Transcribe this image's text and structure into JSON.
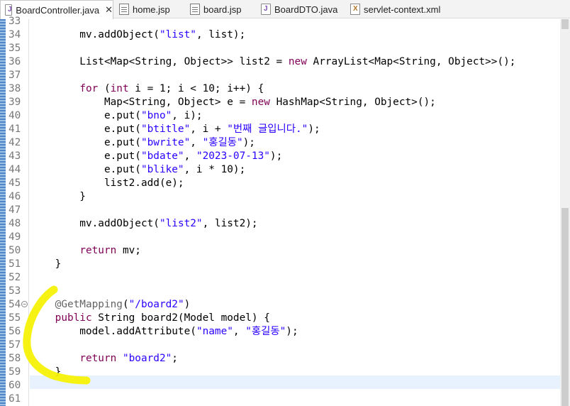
{
  "tabs": [
    {
      "label": "BoardController.java",
      "icon": "java-file-icon",
      "active": true,
      "close": "✕"
    },
    {
      "label": "home.jsp",
      "icon": "jsp-file-icon",
      "active": false
    },
    {
      "label": "board.jsp",
      "icon": "jsp-file-icon",
      "active": false
    },
    {
      "label": "BoardDTO.java",
      "icon": "java-file-icon",
      "active": false
    },
    {
      "label": "servlet-context.xml",
      "icon": "xml-file-icon",
      "active": false
    }
  ],
  "editor": {
    "current_line": 60,
    "lines": [
      {
        "n": "33",
        "tokens": []
      },
      {
        "n": "34",
        "tokens": [
          [
            "p",
            "        mv.addObject("
          ],
          [
            "s",
            "\"list\""
          ],
          [
            "p",
            ", list);"
          ]
        ]
      },
      {
        "n": "35",
        "tokens": []
      },
      {
        "n": "36",
        "tokens": [
          [
            "p",
            "        List<Map<String, Object>> list2 = "
          ],
          [
            "k",
            "new"
          ],
          [
            "p",
            " ArrayList<Map<String, Object>>();"
          ]
        ]
      },
      {
        "n": "37",
        "tokens": []
      },
      {
        "n": "38",
        "tokens": [
          [
            "p",
            "        "
          ],
          [
            "k",
            "for"
          ],
          [
            "p",
            " ("
          ],
          [
            "k",
            "int"
          ],
          [
            "p",
            " i = 1; i < 10; i++) {"
          ]
        ]
      },
      {
        "n": "39",
        "tokens": [
          [
            "p",
            "            Map<String, Object> e = "
          ],
          [
            "k",
            "new"
          ],
          [
            "p",
            " HashMap<String, Object>();"
          ]
        ]
      },
      {
        "n": "40",
        "tokens": [
          [
            "p",
            "            e.put("
          ],
          [
            "s",
            "\"bno\""
          ],
          [
            "p",
            ", i);"
          ]
        ]
      },
      {
        "n": "41",
        "tokens": [
          [
            "p",
            "            e.put("
          ],
          [
            "s",
            "\"btitle\""
          ],
          [
            "p",
            ", i + "
          ],
          [
            "s",
            "\"번째 글입니다.\""
          ],
          [
            "p",
            ");"
          ]
        ]
      },
      {
        "n": "42",
        "tokens": [
          [
            "p",
            "            e.put("
          ],
          [
            "s",
            "\"bwrite\""
          ],
          [
            "p",
            ", "
          ],
          [
            "s",
            "\"홍길동\""
          ],
          [
            "p",
            ");"
          ]
        ]
      },
      {
        "n": "43",
        "tokens": [
          [
            "p",
            "            e.put("
          ],
          [
            "s",
            "\"bdate\""
          ],
          [
            "p",
            ", "
          ],
          [
            "s",
            "\"2023-07-13\""
          ],
          [
            "p",
            ");"
          ]
        ]
      },
      {
        "n": "44",
        "tokens": [
          [
            "p",
            "            e.put("
          ],
          [
            "s",
            "\"blike\""
          ],
          [
            "p",
            ", i * 10);"
          ]
        ]
      },
      {
        "n": "45",
        "tokens": [
          [
            "p",
            "            list2.add(e);"
          ]
        ]
      },
      {
        "n": "46",
        "tokens": [
          [
            "p",
            "        }"
          ]
        ]
      },
      {
        "n": "47",
        "tokens": []
      },
      {
        "n": "48",
        "tokens": [
          [
            "p",
            "        mv.addObject("
          ],
          [
            "s",
            "\"list2\""
          ],
          [
            "p",
            ", list2);"
          ]
        ]
      },
      {
        "n": "49",
        "tokens": []
      },
      {
        "n": "50",
        "tokens": [
          [
            "p",
            "        "
          ],
          [
            "k",
            "return"
          ],
          [
            "p",
            " mv;"
          ]
        ]
      },
      {
        "n": "51",
        "tokens": [
          [
            "p",
            "    }"
          ]
        ]
      },
      {
        "n": "52",
        "tokens": []
      },
      {
        "n": "53",
        "tokens": []
      },
      {
        "n": "54",
        "fold": "−",
        "tokens": [
          [
            "a",
            "    @GetMapping"
          ],
          [
            "p",
            "("
          ],
          [
            "s",
            "\"/board2\""
          ],
          [
            "p",
            ")"
          ]
        ]
      },
      {
        "n": "55",
        "tokens": [
          [
            "p",
            "    "
          ],
          [
            "k",
            "public"
          ],
          [
            "p",
            " String board2(Model model) {"
          ]
        ]
      },
      {
        "n": "56",
        "tokens": [
          [
            "p",
            "        model.addAttribute("
          ],
          [
            "s",
            "\"name\""
          ],
          [
            "p",
            ", "
          ],
          [
            "s",
            "\"홍길동\""
          ],
          [
            "p",
            ");"
          ]
        ]
      },
      {
        "n": "57",
        "tokens": []
      },
      {
        "n": "58",
        "tokens": [
          [
            "p",
            "        "
          ],
          [
            "k",
            "return"
          ],
          [
            "p",
            " "
          ],
          [
            "s",
            "\"board2\""
          ],
          [
            "p",
            ";"
          ]
        ]
      },
      {
        "n": "59",
        "tokens": [
          [
            "p",
            "    }"
          ]
        ]
      },
      {
        "n": "60",
        "tokens": []
      },
      {
        "n": "61",
        "tokens": []
      }
    ]
  },
  "colors": {
    "keyword": "#7f0055",
    "string": "#2a00ff",
    "annotation": "#646464",
    "highlighter": "#f5f200"
  }
}
